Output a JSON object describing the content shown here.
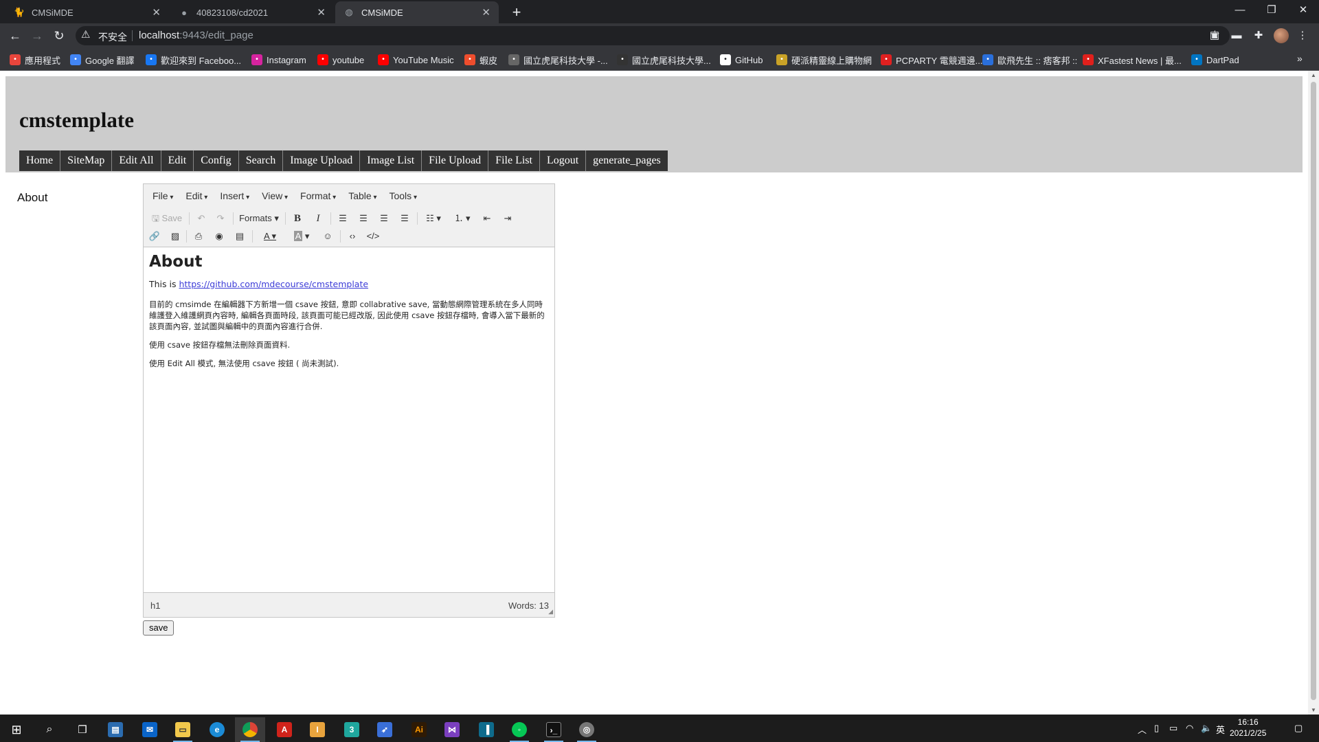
{
  "browser": {
    "tabs": [
      {
        "title": "CMSiMDE",
        "active": false,
        "icon": "cat-icon"
      },
      {
        "title": "40823108/cd2021",
        "active": false,
        "icon": "github-icon"
      },
      {
        "title": "CMSiMDE",
        "active": true,
        "icon": "globe-icon"
      }
    ],
    "address": {
      "insecure_label": "不安全",
      "host": "localhost",
      "path": ":9443/edit_page"
    },
    "bookmarks": [
      {
        "label": "應用程式",
        "icon": "apps-icon",
        "color": "#e8453c"
      },
      {
        "label": "Google 翻譯",
        "icon": "translate-icon",
        "color": "#4285f4"
      },
      {
        "label": "歡迎來到 Faceboo...",
        "icon": "facebook-icon",
        "color": "#1877f2"
      },
      {
        "label": "Instagram",
        "icon": "instagram-icon",
        "color": "#d6249f"
      },
      {
        "label": "youtube",
        "icon": "youtube-icon",
        "color": "#ff0000"
      },
      {
        "label": "YouTube Music",
        "icon": "youtube-music-icon",
        "color": "#ff0000"
      },
      {
        "label": "蝦皮",
        "icon": "shopee-icon",
        "color": "#ee4d2d"
      },
      {
        "label": "國立虎尾科技大學 -...",
        "icon": "nfu-icon",
        "color": "#666666"
      },
      {
        "label": "國立虎尾科技大學...",
        "icon": "cat-icon",
        "color": "#333333"
      },
      {
        "label": "GitHub",
        "icon": "github-icon",
        "color": "#ffffff"
      },
      {
        "label": "硬派精靈線上購物網",
        "icon": "coolpc-icon",
        "color": "#c9a227"
      },
      {
        "label": "PCPARTY 電競週邊...",
        "icon": "pcparty-icon",
        "color": "#e02020"
      },
      {
        "label": "歐飛先生 :: 痞客邦 ::",
        "icon": "pixnet-icon",
        "color": "#2a6fdb"
      },
      {
        "label": "XFastest News | 最...",
        "icon": "xfastest-icon",
        "color": "#e0201c"
      },
      {
        "label": "DartPad",
        "icon": "dart-icon",
        "color": "#0175c2"
      }
    ]
  },
  "site": {
    "title": "cmstemplate",
    "nav": [
      "Home",
      "SiteMap",
      "Edit All",
      "Edit",
      "Config",
      "Search",
      "Image Upload",
      "Image List",
      "File Upload",
      "File List",
      "Logout",
      "generate_pages"
    ],
    "sidebar_link": "About"
  },
  "editor": {
    "menus": [
      "File",
      "Edit",
      "Insert",
      "View",
      "Format",
      "Table",
      "Tools"
    ],
    "save_label": "Save",
    "formats_label": "Formats",
    "heading": "About",
    "intro_text": "This is ",
    "intro_link": "https://github.com/mdecourse/cmstemplate",
    "paragraphs": [
      "目前的 cmsimde 在編輯器下方新增一個 csave 按鈕, 意即 collabrative save, 當動態網際管理系統在多人同時維護登入維護網頁內容時, 編輯各頁面時段, 該頁面可能已經改版, 因此使用 csave 按鈕存檔時, 會導入當下最新的該頁面內容, 並試圖與編輯中的頁面內容進行合併.",
      "使用 csave 按鈕存檔無法刪除頁面資料.",
      "使用 Edit All 模式, 無法使用 csave 按鈕 ( 尚未測試)."
    ],
    "status_path": "h1",
    "word_count": "Words: 13"
  },
  "page_save_button": "save",
  "taskbar": {
    "time": "16:16",
    "date": "2021/2/25",
    "ime": "英"
  }
}
